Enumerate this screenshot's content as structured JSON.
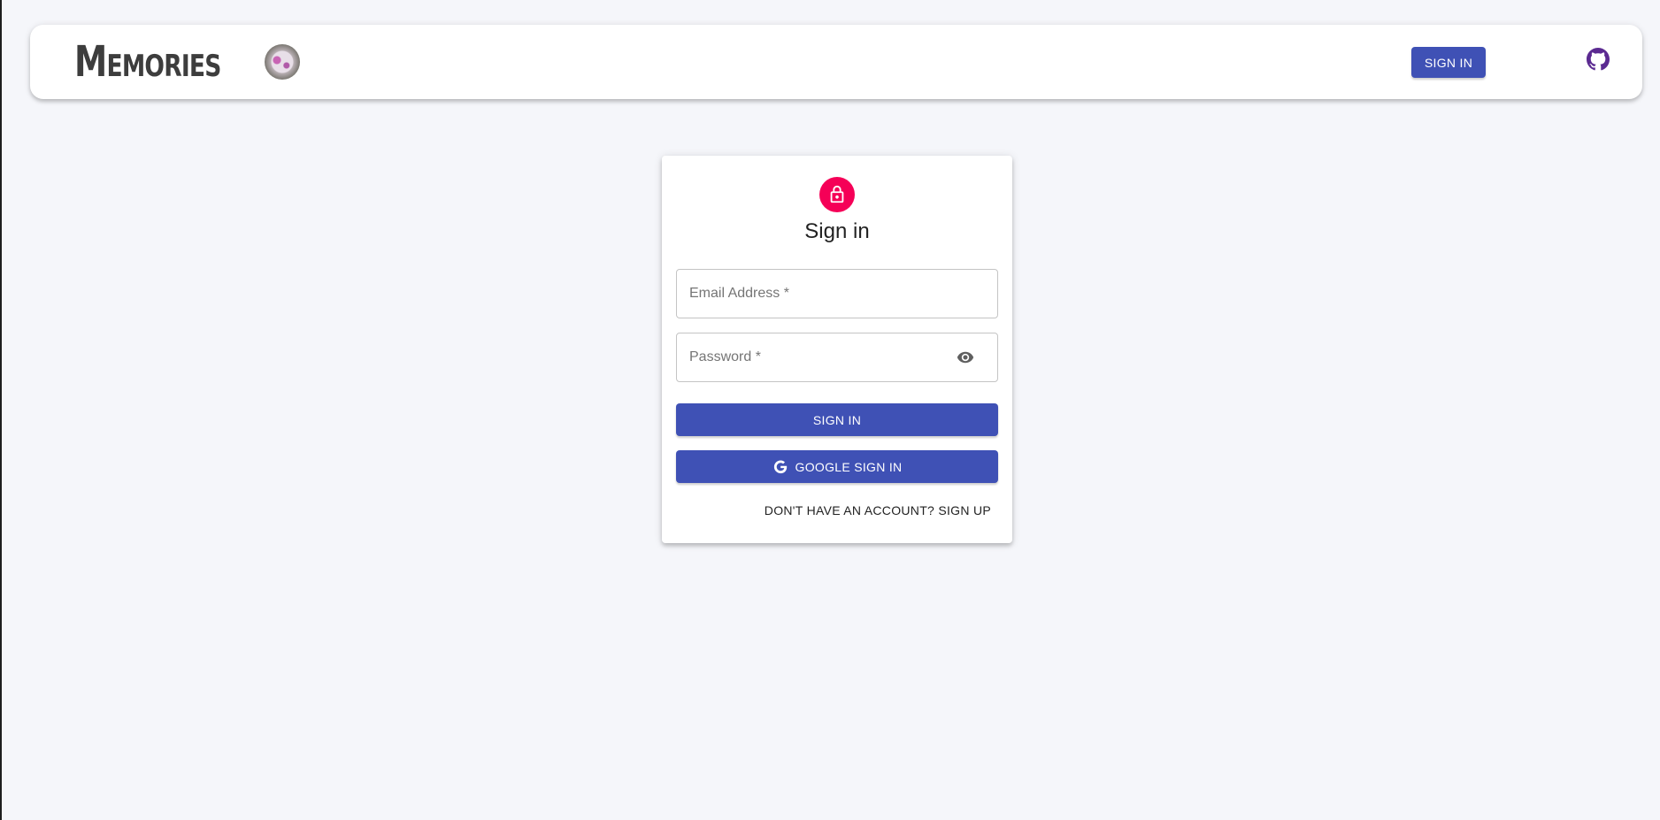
{
  "app": {
    "brand_text": "Memories",
    "nav_signin_label": "SIGN IN"
  },
  "icons": {
    "brand_logo": "memories-flower-logo",
    "github": "github-icon",
    "lock": "lock-icon",
    "eye": "visibility-icon",
    "google": "google-icon"
  },
  "colors": {
    "primary": "#3f51b5",
    "secondary": "#f50057",
    "github": "#5b2a91",
    "background": "#f5f6fa"
  },
  "signin_card": {
    "title": "Sign in",
    "email_placeholder": "Email Address *",
    "password_placeholder": "Password *",
    "signin_button": "SIGN IN",
    "google_button": "GOOGLE SIGN IN",
    "signup_link": "DON'T HAVE AN ACCOUNT? SIGN UP"
  }
}
